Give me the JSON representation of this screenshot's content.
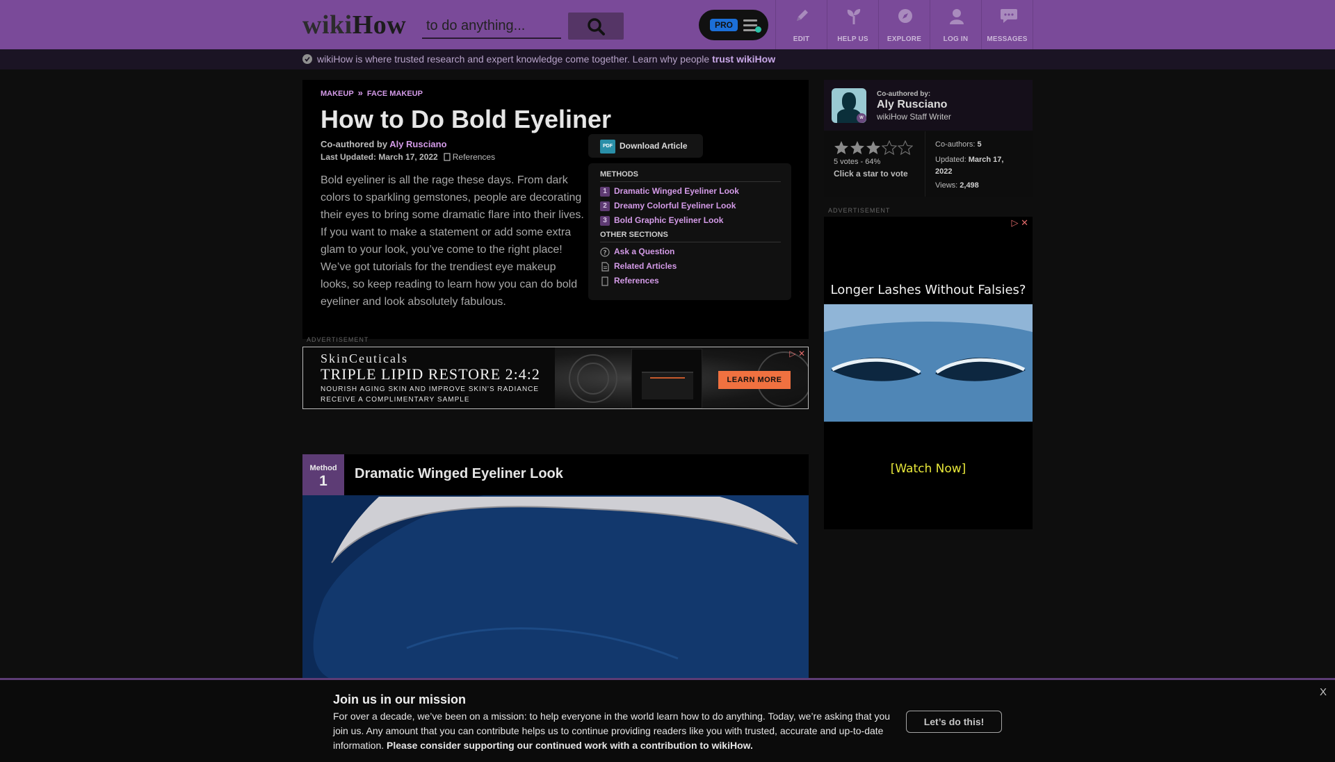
{
  "header": {
    "logo_wiki": "wiki",
    "logo_how": "How",
    "search_placeholder": "to do anything...",
    "pro_label": "PRO",
    "nav": [
      "EDIT",
      "HELP US",
      "EXPLORE",
      "LOG IN",
      "MESSAGES"
    ]
  },
  "trust": {
    "text": "wikiHow is where trusted research and expert knowledge come together. Learn why people ",
    "link": "trust wikiHow"
  },
  "article": {
    "breadcrumb": [
      "MAKEUP",
      "FACE MAKEUP"
    ],
    "breadcrumb_sep": "»",
    "title": "How to Do Bold Eyeliner",
    "coauthored_prefix": "Co-authored by ",
    "author": "Aly Rusciano",
    "updated": "Last Updated: March 17, 2022",
    "references_label": "References",
    "intro": "Bold eyeliner is all the rage these days. From dark colors to sparkling gemstones, people are decorating their eyes to bring some dramatic flare into their lives. If you want to make a statement or add some extra glam to your look, you’ve come to the right place! We’ve got tutorials for the trendiest eye makeup looks, so keep reading to learn how you can do bold eyeliner and look absolutely fabulous.",
    "download_label": "Download Article",
    "pdf_icon_text": "PDF"
  },
  "toc": {
    "methods_head": "METHODS",
    "methods": [
      {
        "num": "1",
        "label": "Dramatic Winged Eyeliner Look"
      },
      {
        "num": "2",
        "label": "Dreamy Colorful Eyeliner Look"
      },
      {
        "num": "3",
        "label": "Bold Graphic Eyeliner Look"
      }
    ],
    "other_head": "OTHER SECTIONS",
    "other": [
      "Ask a Question",
      "Related Articles",
      "References"
    ]
  },
  "ads": {
    "label": "ADVERTISEMENT",
    "banner": {
      "brand": "SkinCeuticals",
      "headline": "TRIPLE LIPID RESTORE 2:4:2",
      "sub1": "NOURISH AGING SKIN AND IMPROVE SKIN'S RADIANCE",
      "sub2": "RECEIVE A COMPLIMENTARY SAMPLE",
      "cta": "LEARN MORE"
    },
    "side": {
      "headline": "Longer Lashes Without Falsies?",
      "cta": "[Watch Now]"
    }
  },
  "method1": {
    "tag": "Method",
    "num": "1",
    "title": "Dramatic Winged Eyeliner Look"
  },
  "sidebar": {
    "coauthored_by": "Co-authored by:",
    "author": "Aly Rusciano",
    "role": "wikiHow Staff Writer",
    "avatar_badge": "W",
    "rating": {
      "filled": 3,
      "total": 5
    },
    "votes": "5 votes - 64%",
    "click_star": "Click a star to vote",
    "coauthors_label": "Co-authors: ",
    "coauthors_value": "5",
    "updated_label": "Updated: ",
    "updated_value": "March 17, 2022",
    "views_label": "Views: ",
    "views_value": "2,498"
  },
  "mission": {
    "title": "Join us in our mission",
    "body": "For over a decade, we’ve been on a mission: to help everyone in the world learn how to do anything. Today, we’re asking that you join us. Any amount that you can contribute helps us to continue providing readers like you with trusted, accurate and up-to-date information. ",
    "body_bold": "Please consider supporting our continued work with a contribution to wikiHow.",
    "button": "Let’s do this!",
    "close": "X"
  },
  "colors": {
    "header_bg": "#7a4a99",
    "accent_link": "#d49be8",
    "method_tag": "#5d3c75"
  }
}
